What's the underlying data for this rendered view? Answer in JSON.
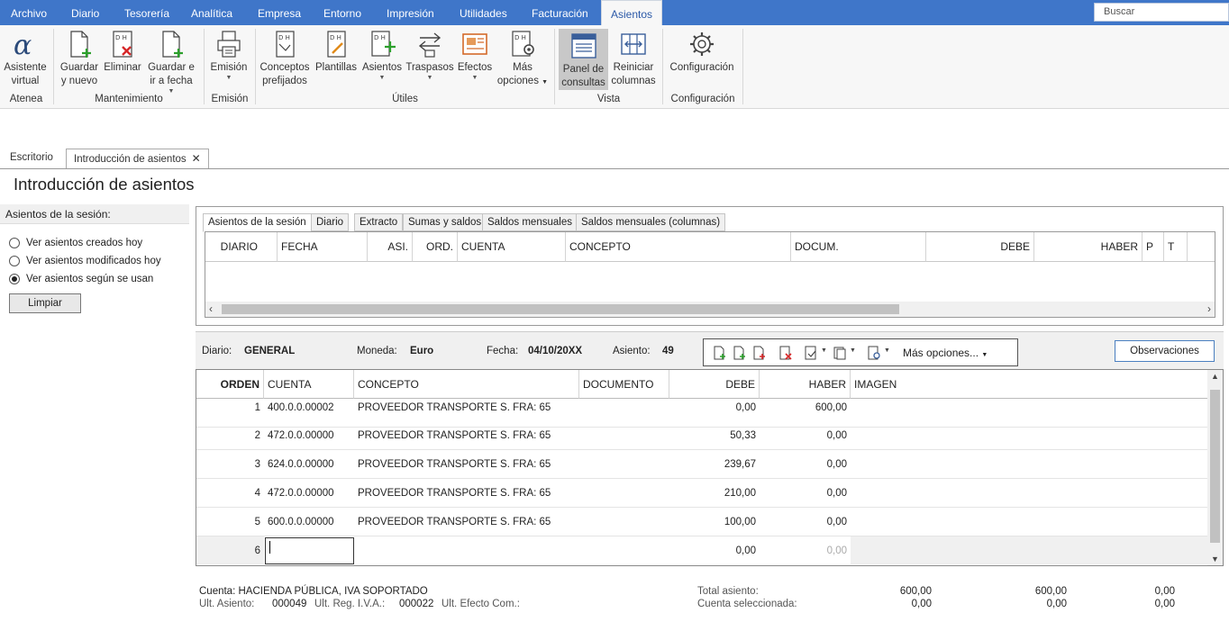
{
  "menu": {
    "items": [
      "Archivo",
      "Diario",
      "Tesorería",
      "Analítica",
      "Empresa",
      "Entorno",
      "Impresión",
      "Utilidades",
      "Facturación",
      "Asientos"
    ],
    "active": "Asientos",
    "search_placeholder": "Buscar"
  },
  "ribbon": {
    "groups": {
      "atenea": "Atenea",
      "mantenimiento": "Mantenimiento",
      "emision": "Emisión",
      "utiles": "Útiles",
      "vista": "Vista",
      "configuracion": "Configuración"
    },
    "buttons": {
      "asistente": [
        "Asistente",
        "virtual"
      ],
      "guardar_nuevo": [
        "Guardar",
        "y nuevo"
      ],
      "eliminar": [
        "Eliminar",
        ""
      ],
      "guardar_fecha": [
        "Guardar e",
        "ir a fecha"
      ],
      "emision": [
        "Emisión",
        ""
      ],
      "conceptos": [
        "Conceptos",
        "prefijados"
      ],
      "plantillas": [
        "Plantillas",
        ""
      ],
      "asientos": [
        "Asientos",
        ""
      ],
      "traspasos": [
        "Traspasos",
        ""
      ],
      "efectos": [
        "Efectos",
        ""
      ],
      "mas_opciones": [
        "Más",
        "opciones"
      ],
      "panel": [
        "Panel de",
        "consultas"
      ],
      "reiniciar": [
        "Reiniciar",
        "columnas"
      ],
      "configuracion": [
        "Configuración",
        ""
      ]
    }
  },
  "doc_tabs": {
    "escritorio": "Escritorio",
    "intro": "Introducción de asientos",
    "close": "✕"
  },
  "page_title": "Introducción de asientos",
  "session": {
    "header": "Asientos de la sesión:",
    "options": [
      "Ver asientos creados hoy",
      "Ver asientos modificados hoy",
      "Ver asientos según se usan"
    ],
    "selected_index": 2,
    "clear_button": "Limpiar"
  },
  "consult": {
    "tabs": [
      "Asientos de la sesión",
      "Diario",
      "Extracto",
      "Sumas y saldos",
      "Saldos mensuales",
      "Saldos mensuales (columnas)"
    ],
    "columns": [
      "DIARIO",
      "FECHA",
      "ASI.",
      "ORD.",
      "CUENTA",
      "CONCEPTO",
      "DOCUM.",
      "DEBE",
      "HABER",
      "P",
      "T"
    ]
  },
  "info": {
    "diario_label": "Diario:",
    "diario_value": "GENERAL",
    "moneda_label": "Moneda:",
    "moneda_value": "Euro",
    "fecha_label": "Fecha:",
    "fecha_value": "04/10/20XX",
    "asiento_label": "Asiento:",
    "asiento_value": "49",
    "mas_opciones": "Más opciones...",
    "observaciones": "Observaciones"
  },
  "grid": {
    "columns": {
      "orden": "ORDEN",
      "cuenta": "CUENTA",
      "concepto": "CONCEPTO",
      "documento": "DOCUMENTO",
      "debe": "DEBE",
      "haber": "HABER",
      "imagen": "IMAGEN"
    },
    "rows": [
      {
        "orden": "1",
        "cuenta": "400.0.0.00002",
        "concepto": "PROVEEDOR TRANSPORTE S. FRA:  65",
        "documento": "",
        "debe": "0,00",
        "haber": "600,00"
      },
      {
        "orden": "2",
        "cuenta": "472.0.0.00000",
        "concepto": "PROVEEDOR TRANSPORTE S. FRA:  65",
        "documento": "",
        "debe": "50,33",
        "haber": "0,00"
      },
      {
        "orden": "3",
        "cuenta": "624.0.0.00000",
        "concepto": "PROVEEDOR TRANSPORTE S. FRA:  65",
        "documento": "",
        "debe": "239,67",
        "haber": "0,00"
      },
      {
        "orden": "4",
        "cuenta": "472.0.0.00000",
        "concepto": "PROVEEDOR TRANSPORTE S. FRA:  65",
        "documento": "",
        "debe": "210,00",
        "haber": "0,00"
      },
      {
        "orden": "5",
        "cuenta": "600.0.0.00000",
        "concepto": "PROVEEDOR TRANSPORTE S. FRA:  65",
        "documento": "",
        "debe": "100,00",
        "haber": "0,00"
      }
    ],
    "new_row": {
      "orden": "6",
      "cuenta": "",
      "debe": "0,00",
      "haber": "0,00"
    }
  },
  "footer": {
    "cuenta_label": "Cuenta:",
    "cuenta_value": "HACIENDA PÚBLICA, IVA SOPORTADO",
    "ult_asiento_label": "Ult. Asiento:",
    "ult_asiento_value": "000049",
    "ult_reg_label": "Ult. Reg. I.V.A.:",
    "ult_reg_value": "000022",
    "ult_efecto_label": "Ult. Efecto Com.:",
    "total_label": "Total asiento:",
    "seleccionada_label": "Cuenta seleccionada:",
    "total_values": [
      "600,00",
      "600,00",
      "0,00"
    ],
    "seleccionada_values": [
      "0,00",
      "0,00",
      "0,00"
    ]
  },
  "colors": {
    "menubar": "#3f76c9",
    "accent_green": "#2ca02c",
    "accent_red": "#d62728",
    "button_border": "#4a7fc0"
  }
}
